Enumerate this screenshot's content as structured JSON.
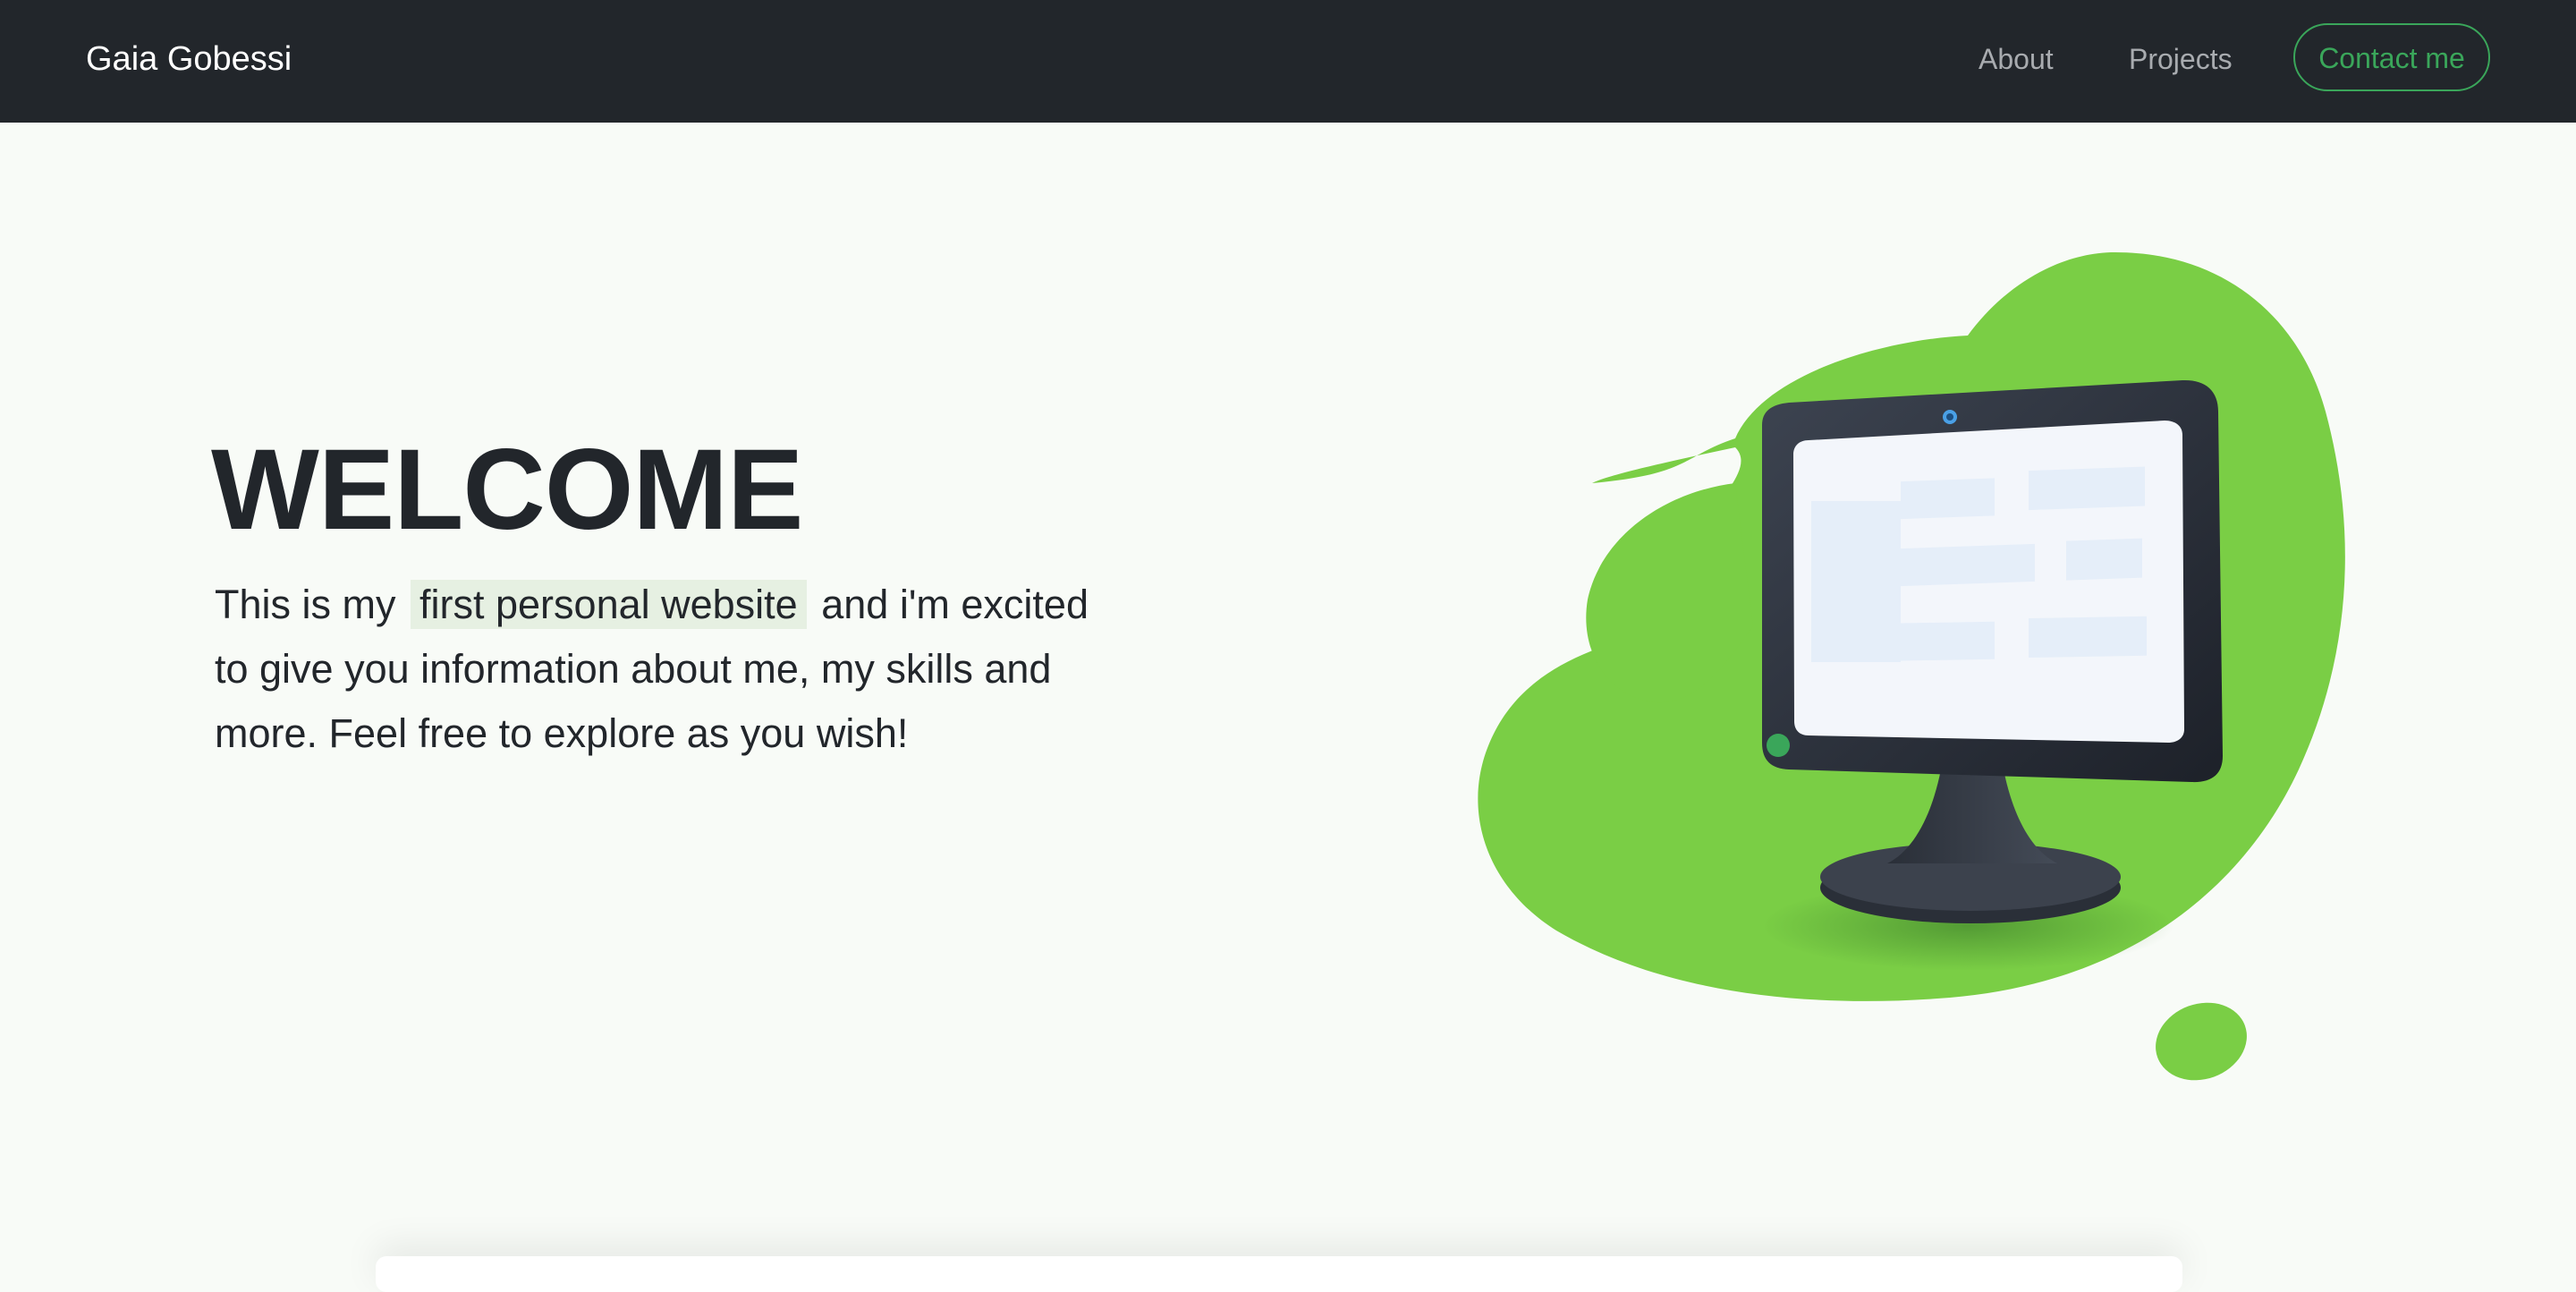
{
  "navbar": {
    "brand": "Gaia Gobessi",
    "links": [
      {
        "label": "About"
      },
      {
        "label": "Projects"
      }
    ],
    "contact_label": "Contact me"
  },
  "hero": {
    "title": "WELCOME",
    "text_before": "This is my",
    "highlight": "first personal website",
    "text_after": "and i'm excited to give you information about me, my skills and more. Feel free to explore as you wish!"
  },
  "illustration": {
    "icon": "computer-monitor-illustration",
    "blob_color": "#7ace45"
  },
  "colors": {
    "nav_bg": "#22262b",
    "accent": "#3aa65a",
    "page_bg": "#f8fbf7",
    "highlight_bg": "#e6f0e2"
  }
}
